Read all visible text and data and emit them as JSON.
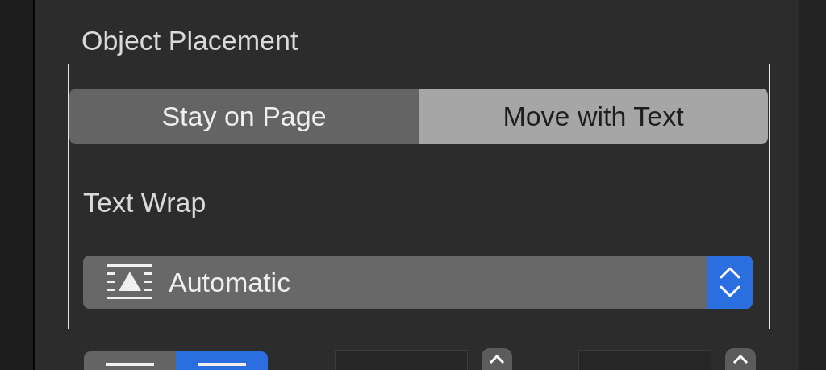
{
  "object_placement": {
    "title": "Object Placement",
    "options": [
      {
        "label": "Stay on Page",
        "selected": false
      },
      {
        "label": "Move with Text",
        "selected": true
      }
    ]
  },
  "text_wrap": {
    "title": "Text Wrap",
    "value": "Automatic"
  },
  "alignment": {
    "options": [
      {
        "selected": false
      },
      {
        "selected": true
      }
    ]
  }
}
